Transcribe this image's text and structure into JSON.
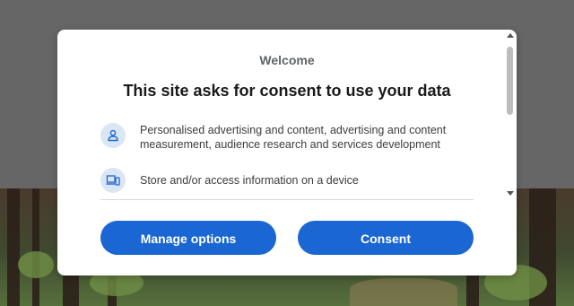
{
  "dialog": {
    "welcome": "Welcome",
    "heading": "This site asks for consent to use your data",
    "purposes": [
      {
        "icon": "person-icon",
        "text": "Personalised advertising and content, advertising and content measurement, audience research and services development"
      },
      {
        "icon": "devices-icon",
        "text": "Store and/or access information on a device"
      }
    ],
    "buttons": {
      "manage_options": "Manage options",
      "consent": "Consent"
    }
  },
  "colors": {
    "accent": "#1a66d2",
    "icon_bg": "#dbe6f5",
    "overlay": "#666666"
  }
}
